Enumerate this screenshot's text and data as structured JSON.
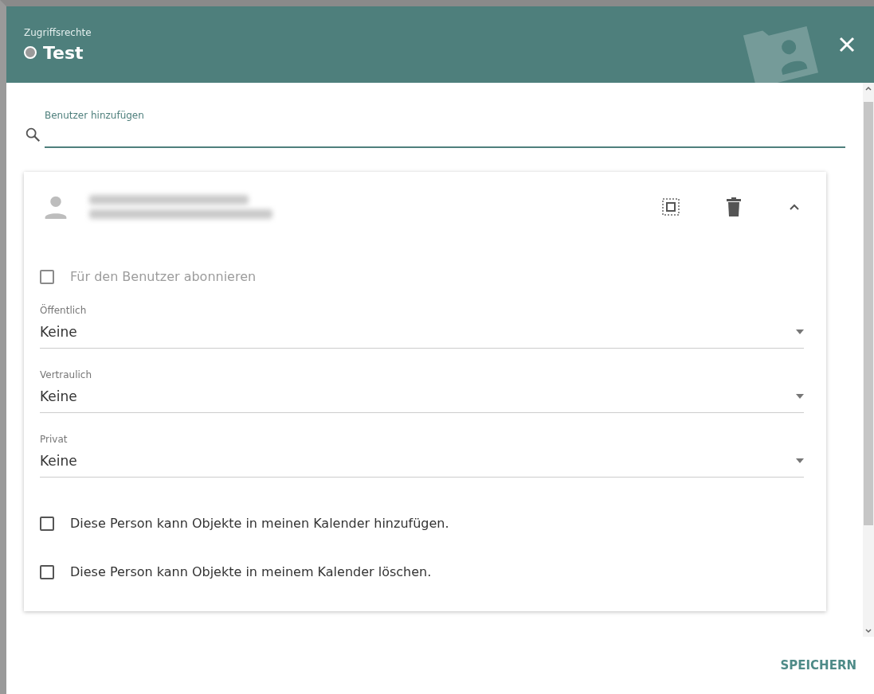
{
  "dialog": {
    "subtitle": "Zugriffsrechte",
    "title": "Test"
  },
  "search": {
    "label": "Benutzer hinzufügen"
  },
  "user": {
    "expanded": true,
    "subscribe": {
      "label": "Für den Benutzer abonnieren",
      "checked": false,
      "disabled": true
    },
    "selects": [
      {
        "label": "Öffentlich",
        "value": "Keine"
      },
      {
        "label": "Vertraulich",
        "value": "Keine"
      },
      {
        "label": "Privat",
        "value": "Keine"
      }
    ],
    "permissions": [
      {
        "label": "Diese Person kann Objekte in meinen Kalender hinzufügen.",
        "checked": false
      },
      {
        "label": "Diese Person kann Objekte in meinem Kalender löschen.",
        "checked": false
      }
    ]
  },
  "footer": {
    "save": "SPEICHERN"
  }
}
